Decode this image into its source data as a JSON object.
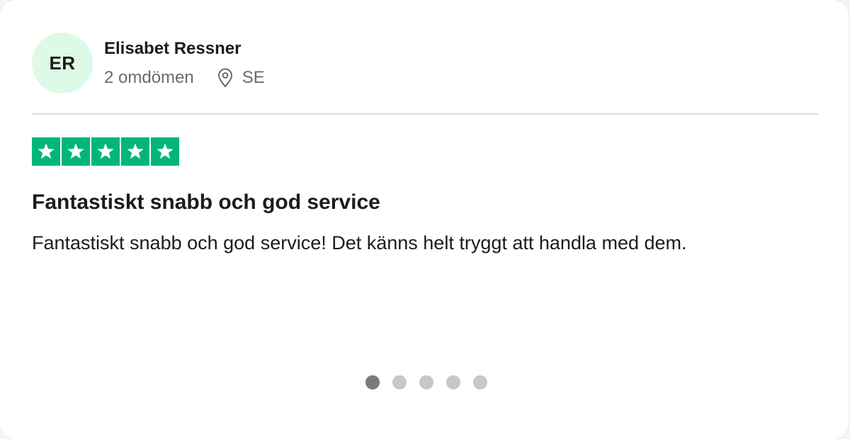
{
  "reviewer": {
    "initials": "ER",
    "name": "Elisabet Ressner",
    "review_count": "2 omdömen",
    "country": "SE",
    "avatar_bg": "#dcfae6"
  },
  "rating": {
    "stars_filled": 5,
    "stars_total": 5,
    "star_color": "#00b67a",
    "icon": "star-icon"
  },
  "review": {
    "title": "Fantastiskt snabb och god service",
    "body": "Fantastiskt snabb och god service! Det känns helt tryggt att handla med dem."
  },
  "pagination": {
    "total": 5,
    "active_index": 0,
    "active_color": "#7b7b78",
    "inactive_color": "#c8c8c3"
  },
  "icons": {
    "location": "location-pin-icon"
  }
}
